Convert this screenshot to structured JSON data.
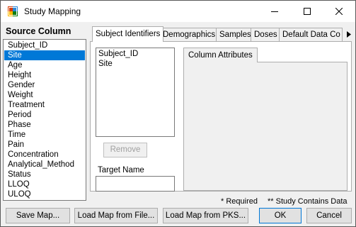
{
  "window": {
    "title": "Study Mapping",
    "icons": [
      "app-icon",
      "minimize-icon",
      "maximize-icon",
      "close-icon"
    ]
  },
  "source": {
    "label": "Source Column",
    "items": [
      "Subject_ID",
      "Site",
      "Age",
      "Height",
      "Gender",
      "Weight",
      "Treatment",
      "Period",
      "Phase",
      "Time",
      "Pain",
      "Concentration",
      "Analytical_Method",
      "Status",
      "LLOQ",
      "ULOQ"
    ],
    "selected": "Site"
  },
  "tabs": [
    "Subject Identifiers",
    "Demographics",
    "Samples",
    "Doses",
    "Default Data Co"
  ],
  "active_tab": "Subject Identifiers",
  "tab_scroll_icon": "right-arrow-icon",
  "subject_ids": {
    "items": [
      "Subject_ID",
      "Site"
    ],
    "remove_label": "Remove",
    "target_name_label": "Target Name",
    "target_name_value": ""
  },
  "attributes": {
    "tab_label": "Column Attributes"
  },
  "notes": {
    "required": "* Required",
    "contains_data": "** Study Contains Data"
  },
  "buttons": {
    "save_map": "Save Map...",
    "load_file": "Load Map from File...",
    "load_pks": "Load Map from PKS...",
    "ok": "OK",
    "cancel": "Cancel"
  },
  "colors": {
    "selection": "#0078d7",
    "window_bg": "#f0f0f0"
  }
}
